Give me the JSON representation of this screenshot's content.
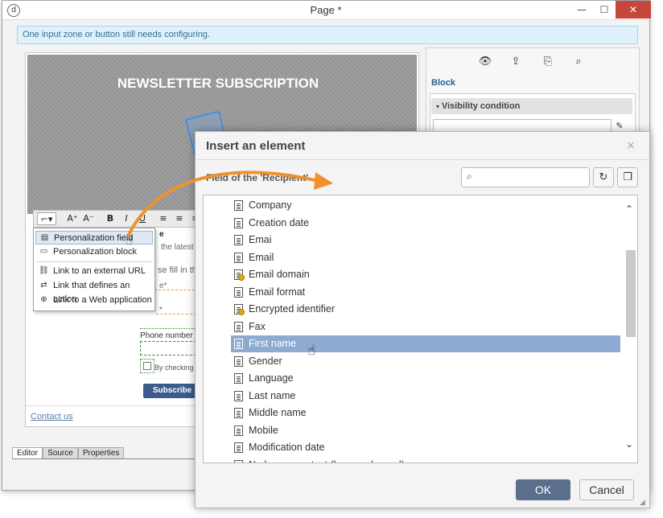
{
  "window": {
    "title": "Page *",
    "minimize": "—",
    "maximize": "☐",
    "close": "✕",
    "app_icon": "d"
  },
  "info_message": "One input zone or button still needs configuring.",
  "editor": {
    "hero_title": "NEWSLETTER SUBSCRIPTION",
    "peek_latest": "the latest",
    "peek_fill": "se fill in th",
    "peek_e": "e*",
    "peek_star": "*",
    "peek_e2": "e",
    "phone_label": "Phone number",
    "checkbox_label": "By checking",
    "subscribe_label": "Subscribe",
    "contact_link": "Contact us"
  },
  "bottom_tabs": [
    "Editor",
    "Source",
    "Properties"
  ],
  "right_panel": {
    "block_label": "Block",
    "visibility_condition": "Visibility condition",
    "icons": [
      "eye-icon",
      "upload-icon",
      "export-icon",
      "preview-icon"
    ]
  },
  "toolbar": {
    "insert": "⌐▾",
    "grow": "A⁺",
    "shrink": "A⁻",
    "bold": "B",
    "italic": "I",
    "underline": "U",
    "align_left": "≡",
    "align_center": "≡",
    "align_right": "≡"
  },
  "context_menu": {
    "items": [
      {
        "label": "Personalization field",
        "icon": "field-icon"
      },
      {
        "label": "Personalization block",
        "icon": "block-icon"
      },
      {
        "label": "Link to an external URL",
        "icon": "link-icon"
      },
      {
        "label": "Link that defines an action",
        "icon": "action-link-icon"
      },
      {
        "label": "Link to a Web application",
        "icon": "web-app-icon"
      }
    ]
  },
  "dialog": {
    "title": "Insert an element",
    "close": "×",
    "field_label": "Field of the 'Recipient'",
    "search": {
      "value": "",
      "placeholder": ""
    },
    "fields": [
      {
        "label": "Company",
        "key": false
      },
      {
        "label": "Creation date",
        "key": false
      },
      {
        "label": "Emai",
        "key": false
      },
      {
        "label": "Email",
        "key": false
      },
      {
        "label": "Email domain",
        "key": true
      },
      {
        "label": "Email format",
        "key": false
      },
      {
        "label": "Encrypted identifier",
        "key": true
      },
      {
        "label": "Fax",
        "key": false
      },
      {
        "label": "First name",
        "key": false,
        "selected": true
      },
      {
        "label": "Gender",
        "key": false
      },
      {
        "label": "Language",
        "key": false
      },
      {
        "label": "Last name",
        "key": false
      },
      {
        "label": "Middle name",
        "key": false
      },
      {
        "label": "Mobile",
        "key": false
      },
      {
        "label": "Modification date",
        "key": false
      },
      {
        "label": "No longer contact (by any channel)",
        "key": false
      }
    ],
    "ok": "OK",
    "cancel": "Cancel"
  },
  "colors": {
    "accent": "#5b6f8c",
    "selection": "#8eaad0",
    "info_bg": "#dff1fa",
    "arrow": "#f0922b"
  }
}
